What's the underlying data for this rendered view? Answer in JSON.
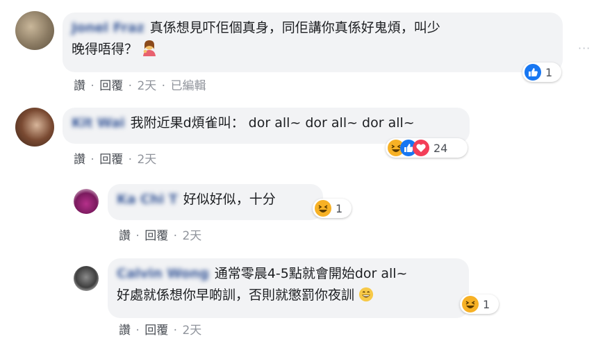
{
  "comments": [
    {
      "author": "Jonel Fraz",
      "text_lines": [
        "真係想見吓佢個真身，同佢講你真係好鬼煩，叫少",
        "晚得唔得？"
      ],
      "emoji": "woman-shrugging-emoji",
      "actions": {
        "like": "讚",
        "reply": "回覆",
        "time": "2天",
        "edited": "已編輯"
      },
      "reaction_count": "1",
      "reaction_icons": [
        "like-reaction-icon"
      ]
    },
    {
      "author": "Kit Wai",
      "text_lines": [
        "我附近果d煩雀叫： dor all~ dor all~ dor all~"
      ],
      "actions": {
        "like": "讚",
        "reply": "回覆",
        "time": "2天"
      },
      "reaction_count": "24",
      "reaction_icons": [
        "haha-reaction-icon",
        "like-reaction-icon",
        "love-reaction-icon"
      ]
    },
    {
      "author": "Ka Chi T",
      "text_lines": [
        "好似好似，十分"
      ],
      "actions": {
        "like": "讚",
        "reply": "回覆",
        "time": "2天"
      },
      "reaction_count": "1",
      "reaction_icons": [
        "haha-reaction-icon"
      ]
    },
    {
      "author": "Calvin Wong",
      "text_lines": [
        "通常零晨4-5點就會開始dor all~",
        "好處就係想你早啲訓，否則就懲罰你夜訓"
      ],
      "emoji": "grinning-emoji",
      "actions": {
        "like": "讚",
        "reply": "回覆",
        "time": "2天"
      },
      "reaction_count": "1",
      "reaction_icons": [
        "haha-reaction-icon"
      ]
    }
  ],
  "more_options": "···",
  "colors": {
    "link": "#385898",
    "bubble": "#f2f3f5",
    "like_blue": "#1877f2",
    "love_red": "#f33e58",
    "haha_yellow": "#f7b125"
  }
}
